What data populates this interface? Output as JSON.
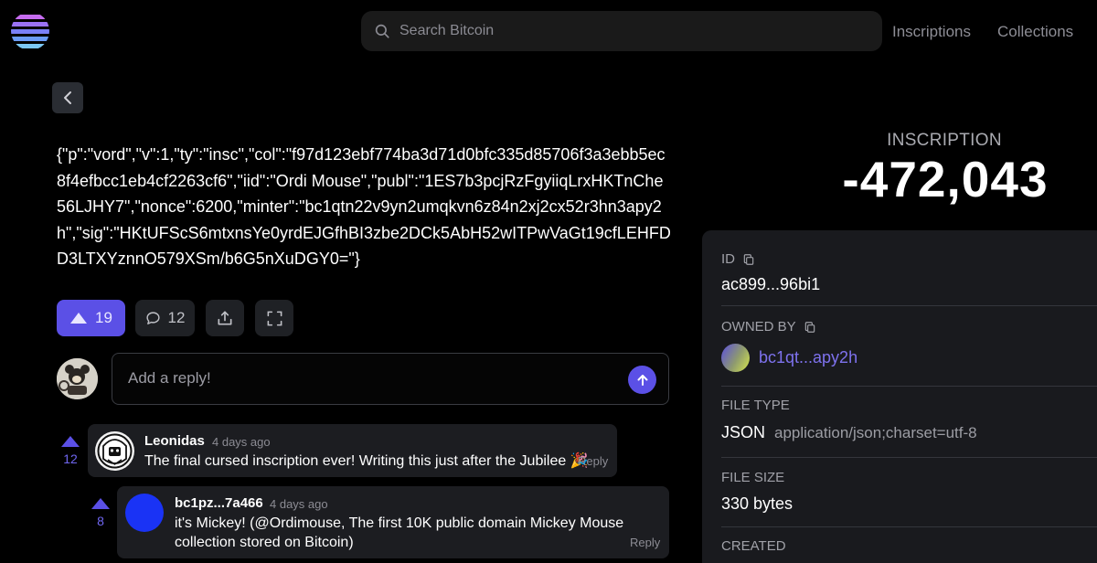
{
  "header": {
    "search_placeholder": "Search Bitcoin",
    "nav": [
      "Inscriptions",
      "Collections"
    ]
  },
  "content": {
    "text": "{\"p\":\"vord\",\"v\":1,\"ty\":\"insc\",\"col\":\"f97d123ebf774ba3d71d0bfc335d85706f3a3ebb5ec8f4efbcc1eb4cf2263cf6\",\"iid\":\"Ordi Mouse\",\"publ\":\"1ES7b3pcjRzFgyiiqLrxHKTnChe56LJHY7\",\"nonce\":6200,\"minter\":\"bc1qtn22v9yn2umqkvn6z84n2xj2cx52r3hn3apy2h\",\"sig\":\"HKtUFScS6mtxnsYe0yrdEJGfhBI3zbe2DCk5AbH52wITPwVaGt19cfLEHFDD3LTXYznnO579XSm/b6G5nXuDGY0=\"}"
  },
  "actions": {
    "upvotes": "19",
    "replies": "12"
  },
  "reply": {
    "placeholder": "Add a reply!"
  },
  "comments": [
    {
      "votes": "12",
      "author": "Leonidas",
      "time": "4 days ago",
      "body": "The final cursed inscription ever! Writing this just after the Jubilee 🎉",
      "reply_label": "Reply"
    },
    {
      "votes": "8",
      "author": "bc1pz...7a466",
      "time": "4 days ago",
      "body_line1": "it's Mickey! (@Ordimouse, The first 10K public domain Mickey Mouse",
      "body_line2": "collection stored on Bitcoin)",
      "reply_label": "Reply"
    }
  ],
  "inscription": {
    "label": "INSCRIPTION",
    "number": "-472,043"
  },
  "details": {
    "id_label": "ID",
    "id_value": "ac899...96bi1",
    "owner_label": "OWNED BY",
    "owner_value": "bc1qt...apy2h",
    "filetype_label": "FILE TYPE",
    "filetype_value": "JSON",
    "mime": "application/json;charset=utf-8",
    "filesize_label": "FILE SIZE",
    "filesize_value": "330 bytes",
    "created_label": "CREATED"
  },
  "colors": {
    "accent": "#5b50e6",
    "background": "#000000",
    "panel": "#191a1e"
  }
}
